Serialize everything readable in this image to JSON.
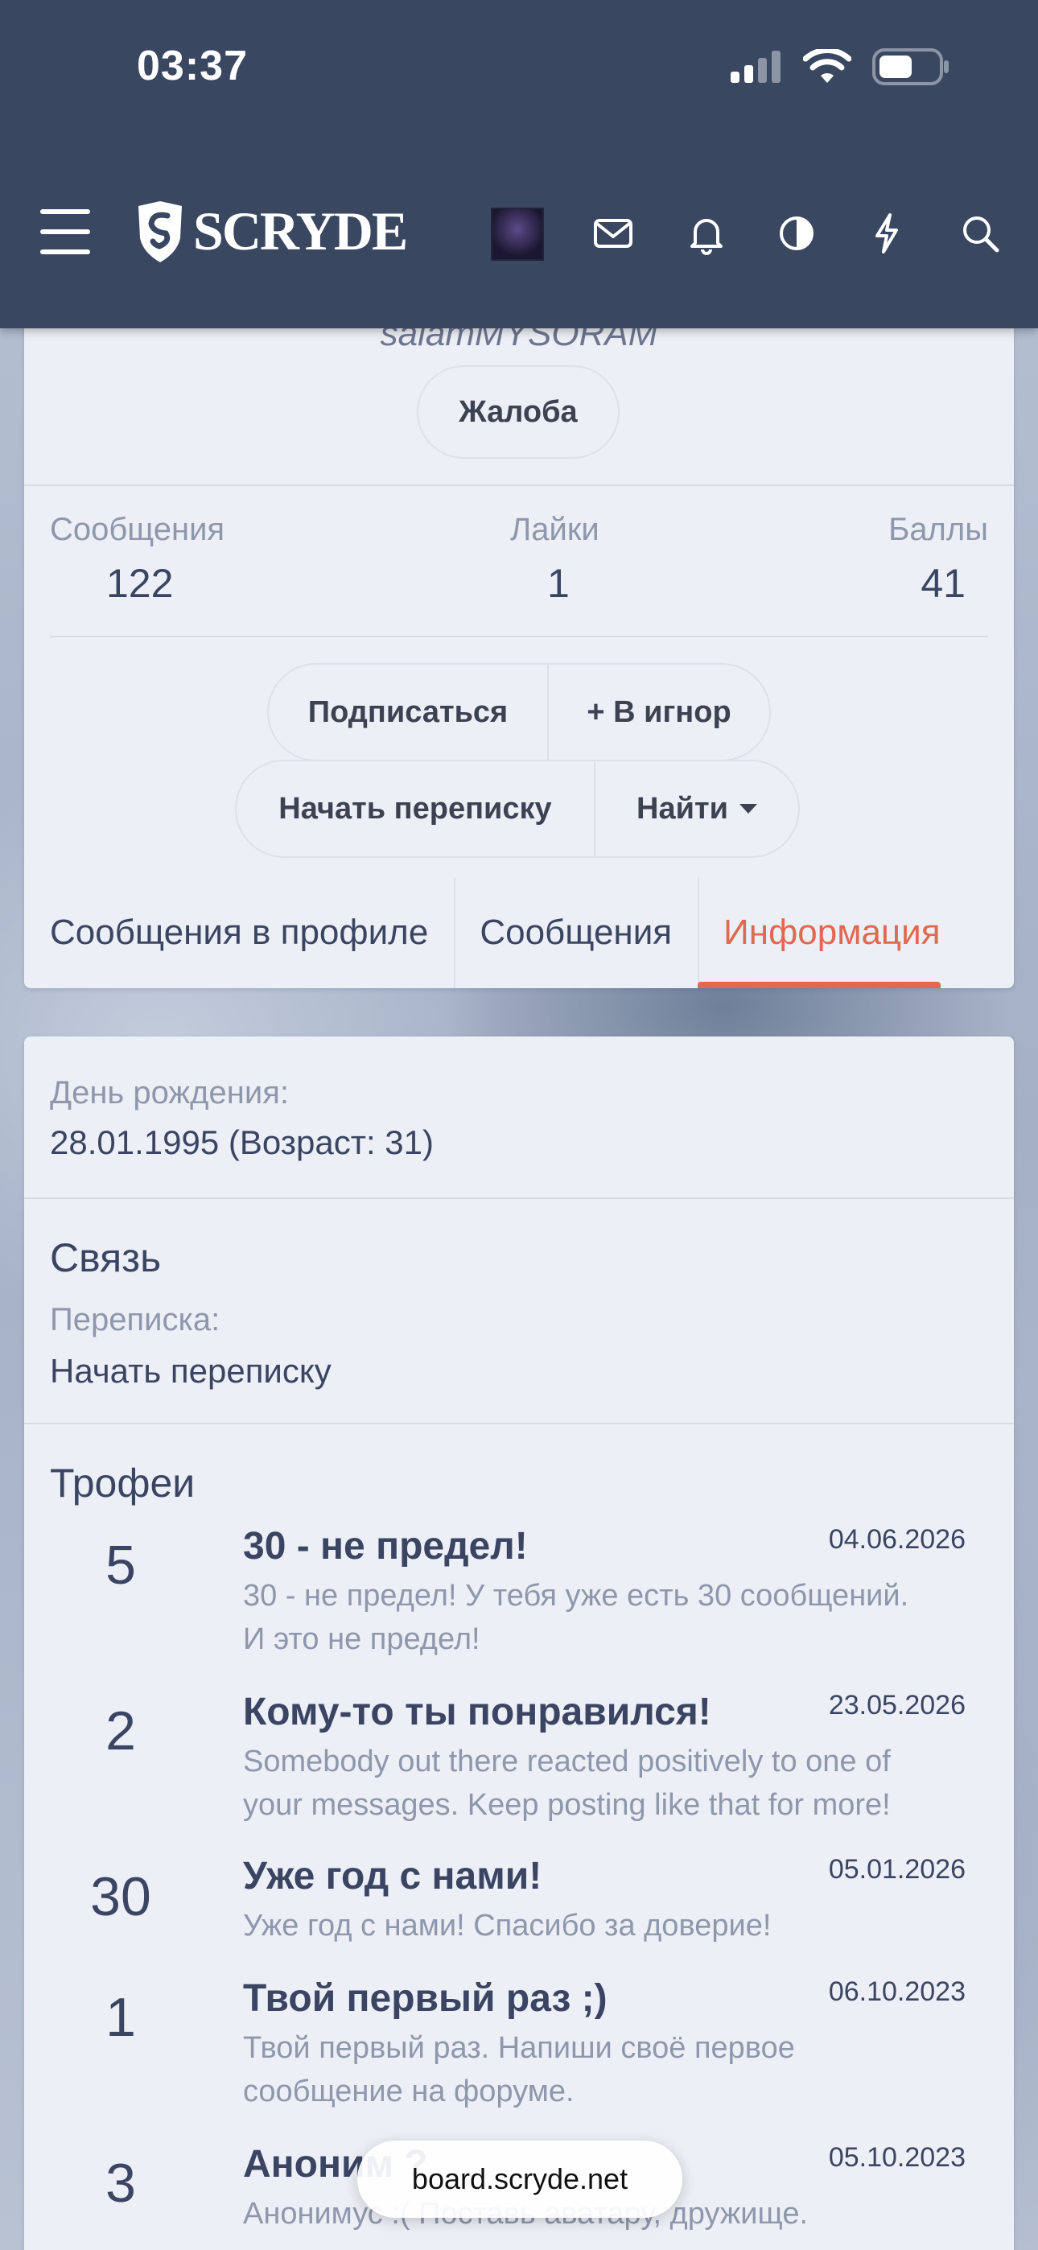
{
  "status_bar": {
    "time": "03:37"
  },
  "header": {
    "logo_text": "SCRYDE"
  },
  "profile": {
    "username": "salamMYSORAM",
    "report_label": "Жалоба",
    "stats": [
      {
        "label": "Сообщения",
        "value": "122"
      },
      {
        "label": "Лайки",
        "value": "1"
      },
      {
        "label": "Баллы",
        "value": "41"
      }
    ],
    "actions": {
      "subscribe": "Подписаться",
      "ignore": "+ В игнор",
      "start_conversation": "Начать переписку",
      "find": "Найти"
    },
    "tabs": [
      {
        "label": "Сообщения в профиле"
      },
      {
        "label": "Сообщения"
      },
      {
        "label": "Информация",
        "active": true
      }
    ]
  },
  "info": {
    "birthday_label": "День рождения:",
    "birthday_value": "28.01.1995 (Возраст: 31)",
    "contact_heading": "Связь",
    "conversation_label": "Переписка:",
    "conversation_value": "Начать переписку",
    "trophies_heading": "Трофеи",
    "trophies": [
      {
        "points": "5",
        "title": "30 - не предел!",
        "date": "04.06.2026",
        "desc": "30 - не предел! У тебя уже есть 30 сообщений. И это не предел!"
      },
      {
        "points": "2",
        "title": "Кому-то ты понравился!",
        "date": "23.05.2026",
        "desc": "Somebody out there reacted positively to one of your messages. Keep posting like that for more!"
      },
      {
        "points": "30",
        "title": "Уже год с нами!",
        "date": "05.01.2026",
        "desc": "Уже год с нами! Спасибо за доверие!"
      },
      {
        "points": "1",
        "title": "Твой первый раз ;)",
        "date": "06.10.2023",
        "desc": "Твой первый раз. Напиши своё первое сообщение на форуме."
      },
      {
        "points": "3",
        "title": "Аноним ?",
        "date": "05.10.2023",
        "desc": "Анонимус :( Поставь аватару, дружище."
      }
    ]
  },
  "browser": {
    "url": "board.scryde.net"
  },
  "colors": {
    "header_bg": "#3a4760",
    "accent": "#e2684f",
    "card_bg": "#eceff5"
  }
}
